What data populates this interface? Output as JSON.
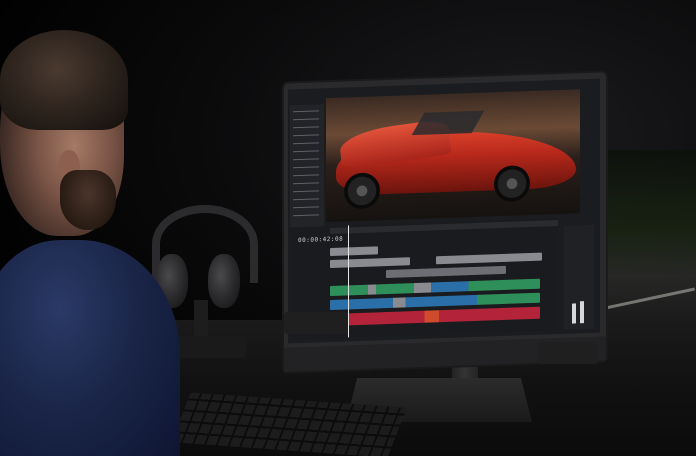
{
  "scene": {
    "timeline_timecode": "00:00:42:08"
  },
  "colors": {
    "background": "#000000",
    "car_red": "#c9341f",
    "track_green": "#2f8f5a",
    "track_blue": "#2a6fa8",
    "track_red": "#b3243a",
    "track_gray": "#8a8b90",
    "sweater_blue": "#1a2548"
  }
}
